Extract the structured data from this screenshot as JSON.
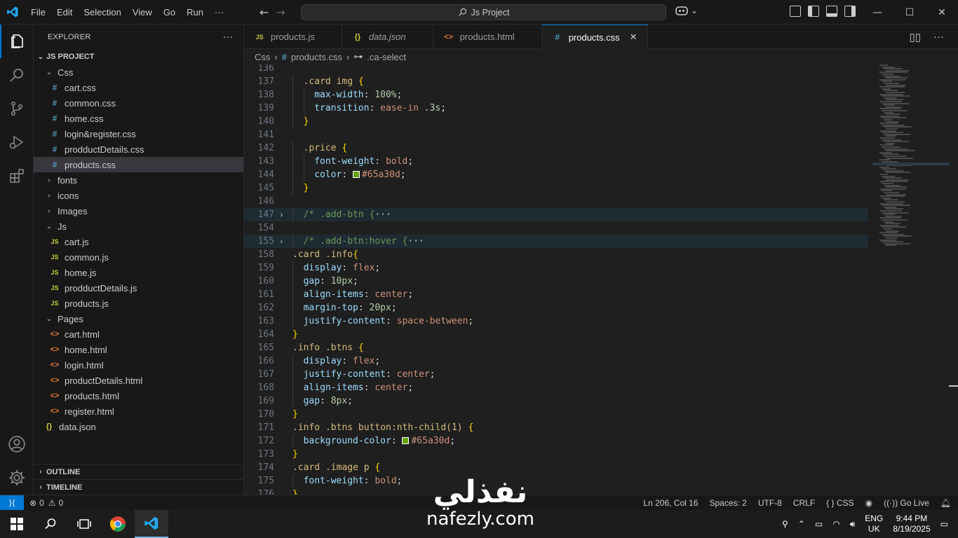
{
  "titlebar": {
    "menu": [
      "File",
      "Edit",
      "Selection",
      "View",
      "Go",
      "Run",
      "···"
    ],
    "search": "Js Project"
  },
  "sidebar": {
    "title": "EXPLORER",
    "project": "JS PROJECT",
    "tree": [
      {
        "label": "Css",
        "type": "folder",
        "open": true,
        "depth": 1
      },
      {
        "label": "cart.css",
        "type": "css",
        "depth": 2
      },
      {
        "label": "common.css",
        "type": "css",
        "depth": 2
      },
      {
        "label": "home.css",
        "type": "css",
        "depth": 2
      },
      {
        "label": "login&register.css",
        "type": "css",
        "depth": 2
      },
      {
        "label": "prodductDetails.css",
        "type": "css",
        "depth": 2
      },
      {
        "label": "products.css",
        "type": "css",
        "depth": 2,
        "selected": true
      },
      {
        "label": "fonts",
        "type": "folder",
        "open": false,
        "depth": 1
      },
      {
        "label": "icons",
        "type": "folder",
        "open": false,
        "depth": 1
      },
      {
        "label": "Images",
        "type": "folder",
        "open": false,
        "depth": 1
      },
      {
        "label": "Js",
        "type": "folder",
        "open": true,
        "depth": 1
      },
      {
        "label": "cart.js",
        "type": "js",
        "depth": 2
      },
      {
        "label": "common.js",
        "type": "js",
        "depth": 2
      },
      {
        "label": "home.js",
        "type": "js",
        "depth": 2
      },
      {
        "label": "prodductDetails.js",
        "type": "js",
        "depth": 2
      },
      {
        "label": "products.js",
        "type": "js",
        "depth": 2
      },
      {
        "label": "Pages",
        "type": "folder",
        "open": true,
        "depth": 1
      },
      {
        "label": "cart.html",
        "type": "html",
        "depth": 2
      },
      {
        "label": "home.html",
        "type": "html",
        "depth": 2
      },
      {
        "label": "login.html",
        "type": "html",
        "depth": 2
      },
      {
        "label": "productDetails.html",
        "type": "html",
        "depth": 2
      },
      {
        "label": "products.html",
        "type": "html",
        "depth": 2
      },
      {
        "label": "register.html",
        "type": "html",
        "depth": 2
      },
      {
        "label": "data.json",
        "type": "json",
        "depth": 1
      }
    ],
    "outline": "OUTLINE",
    "timeline": "TIMELINE"
  },
  "tabs": [
    {
      "label": "products.js",
      "type": "js",
      "active": false,
      "italic": false
    },
    {
      "label": "data.json",
      "type": "json",
      "active": false,
      "italic": true
    },
    {
      "label": "products.html",
      "type": "html",
      "active": false,
      "italic": false
    },
    {
      "label": "products.css",
      "type": "css",
      "active": true,
      "italic": false
    }
  ],
  "breadcrumb": [
    "Css",
    "products.css",
    ".ca-select"
  ],
  "code": [
    {
      "n": "136",
      "t": [],
      "indent": 0
    },
    {
      "n": "137",
      "indent": 1,
      "t": [
        [
          "sel",
          ".card img "
        ],
        [
          "brace",
          "{"
        ]
      ]
    },
    {
      "n": "138",
      "indent": 2,
      "t": [
        [
          "prop",
          "max-width"
        ],
        [
          "punc",
          ": "
        ],
        [
          "num",
          "100%"
        ],
        [
          "punc",
          ";"
        ]
      ]
    },
    {
      "n": "139",
      "indent": 2,
      "t": [
        [
          "prop",
          "transition"
        ],
        [
          "punc",
          ": "
        ],
        [
          "val",
          "ease-in "
        ],
        [
          "num",
          ".3s"
        ],
        [
          "punc",
          ";"
        ]
      ]
    },
    {
      "n": "140",
      "indent": 1,
      "t": [
        [
          "brace",
          "}"
        ]
      ]
    },
    {
      "n": "141",
      "indent": 0,
      "t": []
    },
    {
      "n": "142",
      "indent": 1,
      "t": [
        [
          "sel",
          ".price "
        ],
        [
          "brace",
          "{"
        ]
      ]
    },
    {
      "n": "143",
      "indent": 2,
      "t": [
        [
          "prop",
          "font-weight"
        ],
        [
          "punc",
          ": "
        ],
        [
          "val",
          "bold"
        ],
        [
          "punc",
          ";"
        ]
      ]
    },
    {
      "n": "144",
      "indent": 2,
      "t": [
        [
          "prop",
          "color"
        ],
        [
          "punc",
          ": "
        ],
        [
          "swatch",
          "#65a30d"
        ],
        [
          "val",
          "#65a30d"
        ],
        [
          "punc",
          ";"
        ]
      ]
    },
    {
      "n": "145",
      "indent": 1,
      "t": [
        [
          "brace",
          "}"
        ]
      ]
    },
    {
      "n": "146",
      "indent": 0,
      "t": []
    },
    {
      "n": "147",
      "indent": 1,
      "fold": true,
      "hl": true,
      "t": [
        [
          "cmt",
          "/* .add-btn {"
        ],
        [
          "punc",
          "···"
        ]
      ]
    },
    {
      "n": "154",
      "indent": 0,
      "t": []
    },
    {
      "n": "155",
      "indent": 1,
      "fold": true,
      "hl": true,
      "t": [
        [
          "cmt",
          "/* .add-btn:hover {"
        ],
        [
          "punc",
          "···"
        ]
      ]
    },
    {
      "n": "158",
      "indent": 0,
      "t": [
        [
          "sel",
          ".card .info"
        ],
        [
          "brace",
          "{"
        ]
      ]
    },
    {
      "n": "159",
      "indent": 1,
      "t": [
        [
          "prop",
          "display"
        ],
        [
          "punc",
          ": "
        ],
        [
          "val",
          "flex"
        ],
        [
          "punc",
          ";"
        ]
      ]
    },
    {
      "n": "160",
      "indent": 1,
      "t": [
        [
          "prop",
          "gap"
        ],
        [
          "punc",
          ": "
        ],
        [
          "num",
          "10px"
        ],
        [
          "punc",
          ";"
        ]
      ]
    },
    {
      "n": "161",
      "indent": 1,
      "t": [
        [
          "prop",
          "align-items"
        ],
        [
          "punc",
          ": "
        ],
        [
          "val",
          "center"
        ],
        [
          "punc",
          ";"
        ]
      ]
    },
    {
      "n": "162",
      "indent": 1,
      "t": [
        [
          "prop",
          "margin-top"
        ],
        [
          "punc",
          ": "
        ],
        [
          "num",
          "20px"
        ],
        [
          "punc",
          ";"
        ]
      ]
    },
    {
      "n": "163",
      "indent": 1,
      "t": [
        [
          "prop",
          "justify-content"
        ],
        [
          "punc",
          ": "
        ],
        [
          "val",
          "space-between"
        ],
        [
          "punc",
          ";"
        ]
      ]
    },
    {
      "n": "164",
      "indent": 0,
      "t": [
        [
          "brace",
          "}"
        ]
      ]
    },
    {
      "n": "165",
      "indent": 0,
      "t": [
        [
          "sel",
          ".info .btns "
        ],
        [
          "brace",
          "{"
        ]
      ]
    },
    {
      "n": "166",
      "indent": 1,
      "t": [
        [
          "prop",
          "display"
        ],
        [
          "punc",
          ": "
        ],
        [
          "val",
          "flex"
        ],
        [
          "punc",
          ";"
        ]
      ]
    },
    {
      "n": "167",
      "indent": 1,
      "t": [
        [
          "prop",
          "justify-content"
        ],
        [
          "punc",
          ": "
        ],
        [
          "val",
          "center"
        ],
        [
          "punc",
          ";"
        ]
      ]
    },
    {
      "n": "168",
      "indent": 1,
      "t": [
        [
          "prop",
          "align-items"
        ],
        [
          "punc",
          ": "
        ],
        [
          "val",
          "center"
        ],
        [
          "punc",
          ";"
        ]
      ]
    },
    {
      "n": "169",
      "indent": 1,
      "t": [
        [
          "prop",
          "gap"
        ],
        [
          "punc",
          ": "
        ],
        [
          "num",
          "8px"
        ],
        [
          "punc",
          ";"
        ]
      ]
    },
    {
      "n": "170",
      "indent": 0,
      "t": [
        [
          "brace",
          "}"
        ]
      ]
    },
    {
      "n": "171",
      "indent": 0,
      "t": [
        [
          "sel",
          ".info .btns button:nth-child(1) "
        ],
        [
          "brace",
          "{"
        ]
      ]
    },
    {
      "n": "172",
      "indent": 1,
      "t": [
        [
          "prop",
          "background-color"
        ],
        [
          "punc",
          ": "
        ],
        [
          "swatch",
          "#65a30d"
        ],
        [
          "val",
          "#65a30d"
        ],
        [
          "punc",
          ";"
        ]
      ]
    },
    {
      "n": "173",
      "indent": 0,
      "t": [
        [
          "brace",
          "}"
        ]
      ]
    },
    {
      "n": "174",
      "indent": 0,
      "t": [
        [
          "sel",
          ".card .image p "
        ],
        [
          "brace",
          "{"
        ]
      ]
    },
    {
      "n": "175",
      "indent": 1,
      "t": [
        [
          "prop",
          "font-weight"
        ],
        [
          "punc",
          ": "
        ],
        [
          "val",
          "bold"
        ],
        [
          "punc",
          ";"
        ]
      ]
    },
    {
      "n": "176",
      "indent": 0,
      "t": [
        [
          "brace",
          "}"
        ]
      ]
    }
  ],
  "statusbar": {
    "problems": "0",
    "warnings": "0",
    "position": "Ln 206, Col 16",
    "spaces": "Spaces: 2",
    "encoding": "UTF-8",
    "eol": "CRLF",
    "language": "CSS",
    "golive": "Go Live"
  },
  "taskbar": {
    "lang_top": "ENG",
    "lang_bottom": "UK",
    "time": "9:44 PM",
    "date": "8/19/2025"
  },
  "watermark": {
    "arabic": "نفذلي",
    "latin": "nafezly.com"
  },
  "colors": {
    "accent": "#0078d4",
    "swatch": "#65a30d"
  }
}
